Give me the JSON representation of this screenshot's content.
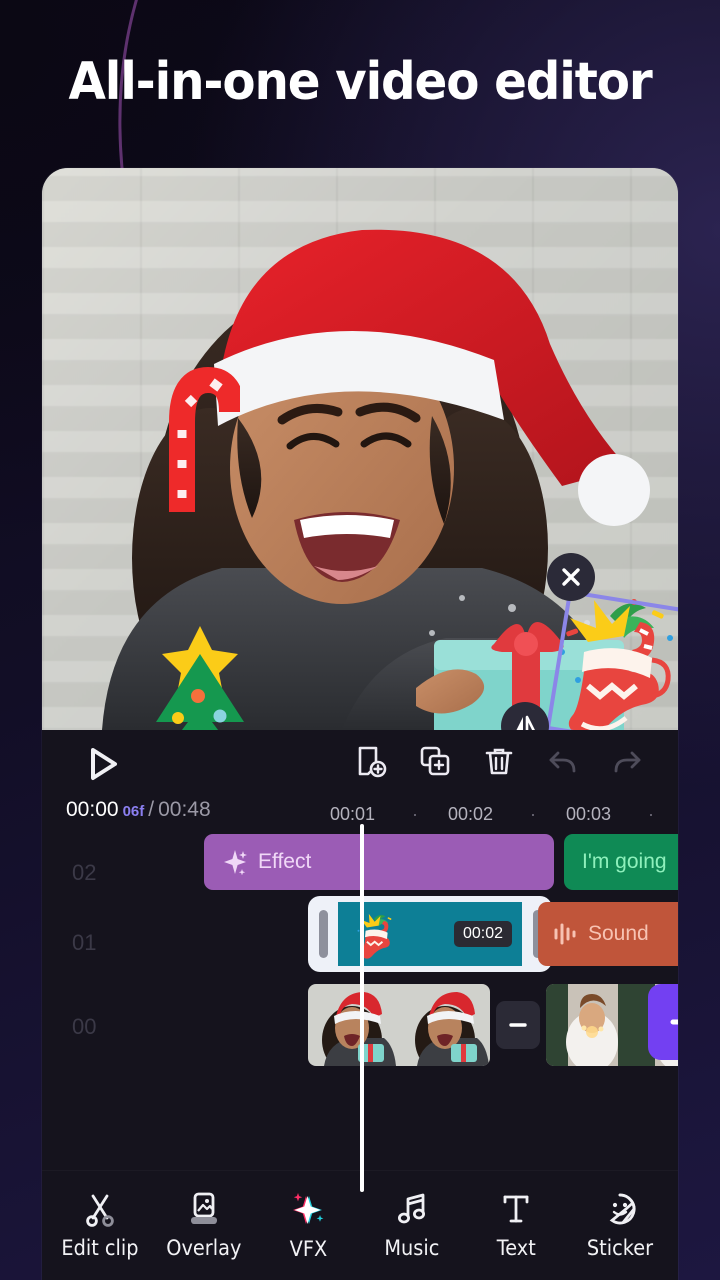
{
  "headline": "All-in-one video editor",
  "preview": {
    "stickers": [
      {
        "name": "candy-cane-sticker"
      },
      {
        "name": "christmas-tree-sticker"
      },
      {
        "name": "gift-boxes-sticker"
      },
      {
        "name": "christmas-stocking-sticker"
      }
    ],
    "selection": {
      "delete_handle": "close-icon",
      "flip_handle": "flip-icon",
      "resize_handle": "resize-icon",
      "box_color": "#8b86e8"
    }
  },
  "toolbar": {
    "play_label": "play-icon",
    "actions": [
      {
        "name": "add-keyframe-button",
        "label": "Add keyframe",
        "disabled": false
      },
      {
        "name": "duplicate-button",
        "label": "Duplicate",
        "disabled": false
      },
      {
        "name": "delete-button",
        "label": "Delete",
        "disabled": false
      },
      {
        "name": "undo-button",
        "label": "Undo",
        "disabled": true
      },
      {
        "name": "redo-button",
        "label": "Redo",
        "disabled": true
      }
    ]
  },
  "timecode": {
    "current": "00:00",
    "frames": "06f",
    "separator": "/",
    "total": "00:48",
    "frames_color": "#8b7ff0"
  },
  "ruler": {
    "ticks": [
      "00:01",
      "00:02",
      "00:03"
    ],
    "dot": "·"
  },
  "tracks": [
    {
      "id": "02",
      "label": "02",
      "clips": [
        {
          "name": "effect-clip",
          "label": "Effect",
          "color": "#9b5cb5",
          "icon": "sparkle-icon"
        },
        {
          "name": "text-clip",
          "label": "I'm going",
          "color": "#0f8a55"
        }
      ]
    },
    {
      "id": "01",
      "label": "01",
      "clips": [
        {
          "name": "sticker-clip-selected",
          "label": "",
          "color": "#0d7f96",
          "duration": "00:02",
          "selected": true
        },
        {
          "name": "sound-clip",
          "label": "Sound",
          "color": "#c0553a",
          "icon": "waveform-icon"
        }
      ]
    },
    {
      "id": "00",
      "label": "00",
      "clips": [
        {
          "name": "video-clip-1",
          "label": "",
          "thumbnails": 2
        },
        {
          "name": "transition-button",
          "label": "transition-icon"
        },
        {
          "name": "video-clip-2",
          "label": "",
          "thumbnails": 2
        },
        {
          "name": "add-media-button",
          "label": "plus-icon",
          "color": "#7340f2"
        }
      ]
    }
  ],
  "bottom_nav": [
    {
      "name": "nav-edit-clip",
      "label": "Edit clip",
      "icon": "scissors-icon",
      "active": false
    },
    {
      "name": "nav-overlay",
      "label": "Overlay",
      "icon": "overlay-icon",
      "active": false
    },
    {
      "name": "nav-vfx",
      "label": "VFX",
      "icon": "vfx-sparkle-icon",
      "active": true
    },
    {
      "name": "nav-music",
      "label": "Music",
      "icon": "music-note-icon",
      "active": false
    },
    {
      "name": "nav-text",
      "label": "Text",
      "icon": "text-t-icon",
      "active": false
    },
    {
      "name": "nav-sticker",
      "label": "Sticker",
      "icon": "sticker-face-icon",
      "active": false
    }
  ]
}
